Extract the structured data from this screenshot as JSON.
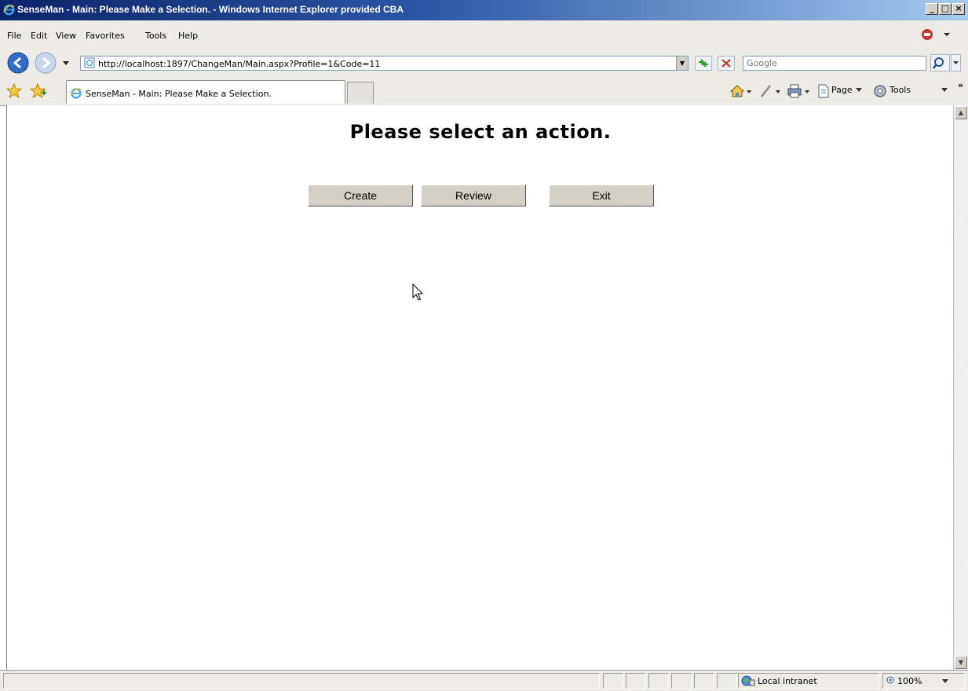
{
  "window": {
    "title": "SenseMan - Main: Please Make a Selection. - Windows Internet Explorer provided CBA",
    "minimize_label": "_",
    "maximize_label": "□",
    "close_label": "×"
  },
  "menu": {
    "items": [
      {
        "label": "File"
      },
      {
        "label": "Edit"
      },
      {
        "label": "View"
      },
      {
        "label": "Favorites"
      },
      {
        "label": "Tools"
      },
      {
        "label": "Help"
      }
    ]
  },
  "address": {
    "url": "http://localhost:1897/ChangeMan/Main.aspx?Profile=1&Code=11"
  },
  "search": {
    "placeholder": "Google"
  },
  "tabs": {
    "active_label": "SenseMan - Main: Please Make a Selection."
  },
  "commands": {
    "page_label": "Page",
    "tools_label": "Tools",
    "more_label": "»"
  },
  "page": {
    "heading": "Please select an action.",
    "buttons": {
      "create": "Create",
      "review": "Review",
      "exit": "Exit"
    }
  },
  "status": {
    "zone": "Local intranet",
    "zoom": "100%"
  },
  "colors": {
    "titlebar_start": "#0a246a",
    "titlebar_end": "#a6caf0",
    "chrome_bg": "#ecebe6",
    "button_face": "#d4d0c8"
  }
}
